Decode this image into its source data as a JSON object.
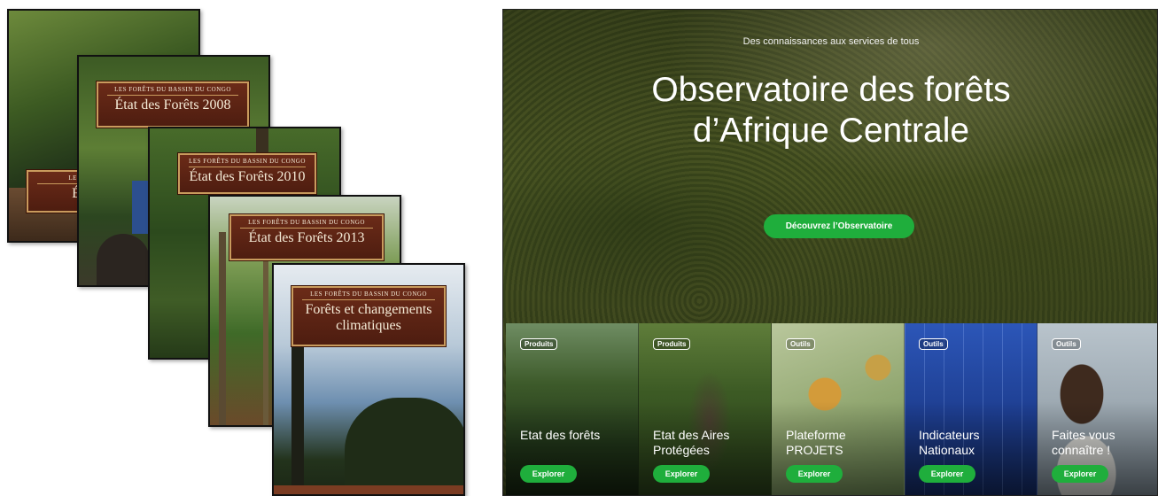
{
  "covers": [
    {
      "series": "Les forêts",
      "title": "État d"
    },
    {
      "series": "Les forêts du bassin du Congo",
      "title": "État des Forêts 2008"
    },
    {
      "series": "Les forêts du bassin du Congo",
      "title": "État des Forêts 2010"
    },
    {
      "series": "Les forêts du bassin du Congo",
      "title": "État des Forêts 2013"
    },
    {
      "series": "Les forêts du bassin du Congo",
      "title": "Forêts et changements climatiques"
    }
  ],
  "site": {
    "tagline": "Des connaissances aux services de tous",
    "title": "Observatoire des forêts d’Afrique Centrale",
    "cta_label": "Découvrez l’Observatoire",
    "cards": [
      {
        "badge": "Produits",
        "title": "Etat des forêts",
        "button": "Explorer"
      },
      {
        "badge": "Produits",
        "title": "Etat des Aires Protégées",
        "button": "Explorer"
      },
      {
        "badge": "Outils",
        "title": "Plateforme PROJETS",
        "button": "Explorer"
      },
      {
        "badge": "Outils",
        "title": "Indicateurs Nationaux",
        "button": "Explorer"
      },
      {
        "badge": "Outils",
        "title": "Faites vous connaître !",
        "button": "Explorer"
      }
    ]
  }
}
